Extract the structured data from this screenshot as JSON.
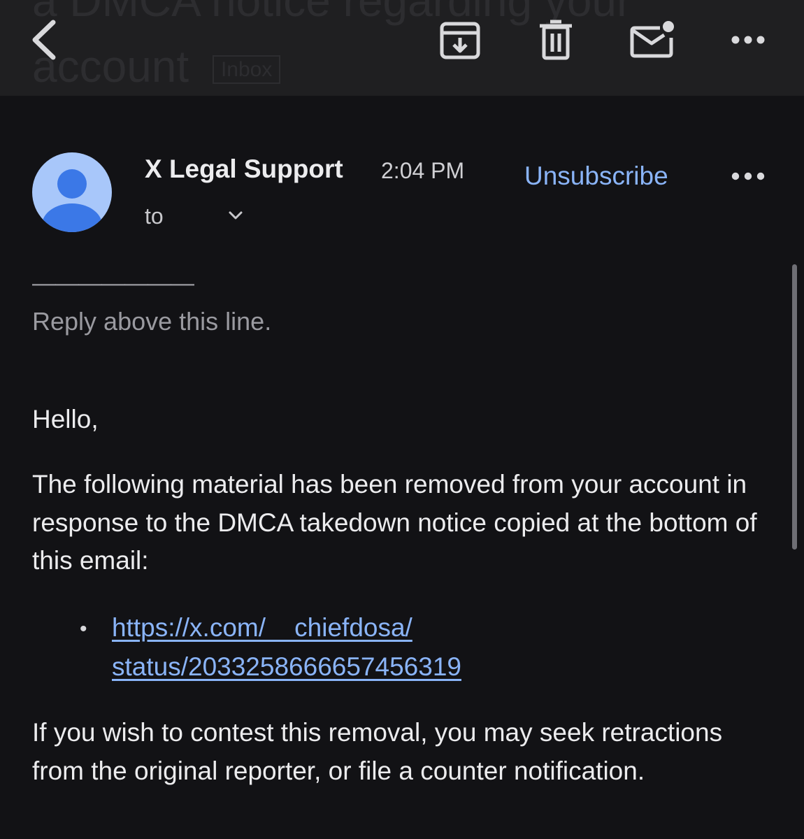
{
  "toolbar": {
    "ghost_subject": "a DMCA notice regarding your account",
    "ghost_label": "Inbox",
    "icons": [
      "back-icon",
      "archive-icon",
      "trash-icon",
      "mark-unread-icon",
      "more-options-icon"
    ]
  },
  "message": {
    "sender_name": "X Legal Support",
    "time": "2:04 PM",
    "unsubscribe": "Unsubscribe",
    "to_label": "to"
  },
  "body": {
    "reply_rule": "———————",
    "reply_hint": "Reply above this line.",
    "greeting": "Hello,",
    "paragraph1": "The following material has been removed from your account in response to the DMCA takedown notice copied at the bottom of this email:",
    "bullet": "•",
    "link_line1": "https://x.com/__chiefdosa/",
    "link_line2": "status/2033258666657456319",
    "paragraph2": "If you wish to contest this removal, you may seek retractions from the original reporter, or file a counter notification."
  },
  "colors": {
    "background": "#121215",
    "toolbar": "#1f1f21",
    "link": "#8ab4f8",
    "avatar_bg": "#a8c7fa",
    "avatar_fg": "#3b78e7"
  }
}
